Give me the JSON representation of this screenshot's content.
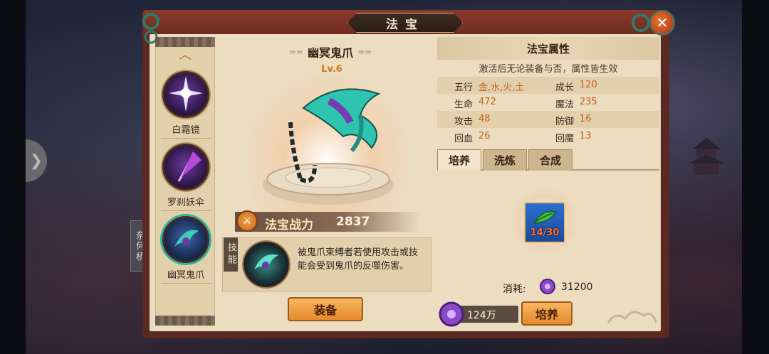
{
  "window": {
    "title": "法宝",
    "close_icon": "close-icon"
  },
  "background": {
    "side_tab": "奈何桥"
  },
  "sidebar": {
    "items": [
      {
        "label": "白霜镜",
        "selected": false
      },
      {
        "label": "罗刹妖伞",
        "selected": false
      },
      {
        "label": "幽冥鬼爪",
        "selected": true
      }
    ]
  },
  "treasure": {
    "name": "幽冥鬼爪",
    "level": "Lv.6",
    "power_label": "法宝战力",
    "power_value": "2837",
    "skill_tab": "技能",
    "skill_desc": "被鬼爪束缚者若使用攻击或技能会受到鬼爪的反噬伤害。",
    "equip_label": "装备"
  },
  "attributes": {
    "title": "法宝属性",
    "subtitle": "激活后无论装备与否，属性皆生效",
    "rows": [
      {
        "k1": "五行",
        "v1": "金,水,火,土",
        "k2": "成长",
        "v2": "120"
      },
      {
        "k1": "生命",
        "v1": "472",
        "k2": "魔法",
        "v2": "235"
      },
      {
        "k1": "攻击",
        "v1": "48",
        "k2": "防御",
        "v2": "16"
      },
      {
        "k1": "回血",
        "v1": "26",
        "k2": "回魔",
        "v2": "13"
      }
    ]
  },
  "tabs": [
    {
      "label": "培养",
      "active": true
    },
    {
      "label": "洗炼",
      "active": false
    },
    {
      "label": "合成",
      "active": false
    }
  ],
  "training": {
    "material_count": "14/30",
    "cost_label": "消耗:",
    "cost_value": "31200",
    "balance": "124万",
    "train_label": "培养"
  },
  "colors": {
    "accent": "#e58a2c",
    "value": "#c4621a",
    "frame": "#5a2a22",
    "paper": "#ecdcc0"
  }
}
